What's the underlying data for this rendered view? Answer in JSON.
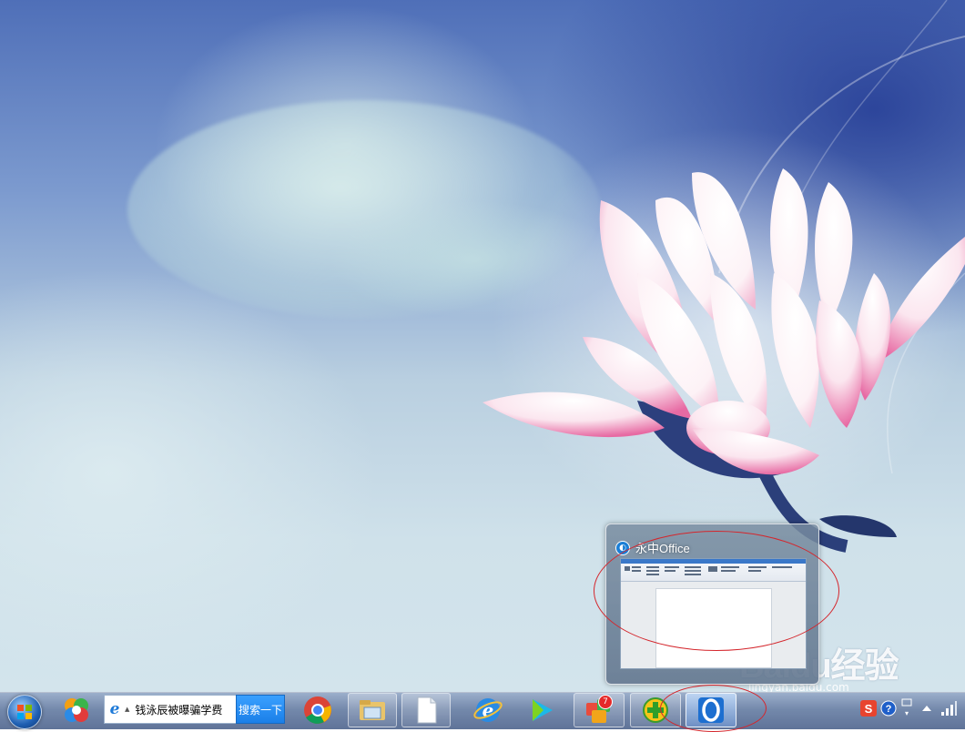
{
  "preview": {
    "app_title": "永中Office",
    "icon": "yozo-office-icon"
  },
  "search": {
    "query": "钱泳辰被曝骗学费",
    "button_label": "搜索一下",
    "engine_icon": "ie-e-icon"
  },
  "taskbar": {
    "items": [
      {
        "name": "start-button",
        "icon": "windows-orb-icon"
      },
      {
        "name": "360-browser",
        "icon": "360-browser-icon"
      },
      {
        "name": "chrome",
        "icon": "chrome-icon"
      },
      {
        "name": "file-explorer",
        "icon": "folder-icon"
      },
      {
        "name": "blank-document",
        "icon": "document-icon"
      },
      {
        "name": "ie-browser",
        "icon": "ie-icon"
      },
      {
        "name": "media-player",
        "icon": "play-icon"
      },
      {
        "name": "app-store",
        "icon": "app-store-icon",
        "badge": "7"
      },
      {
        "name": "360-security",
        "icon": "plus-shield-icon"
      },
      {
        "name": "yozo-office",
        "icon": "yozo-office-icon",
        "active": true
      }
    ]
  },
  "tray": {
    "icons": [
      "sogou-s-icon",
      "help-icon",
      "network-icon",
      "up-arrow-icon",
      "signal-bars-icon"
    ]
  },
  "watermark": {
    "logo": "Baidu经验",
    "url": "jingyan.baidu.com"
  },
  "colors": {
    "annotation": "#d4262c",
    "taskbar": "#6e84a8"
  }
}
